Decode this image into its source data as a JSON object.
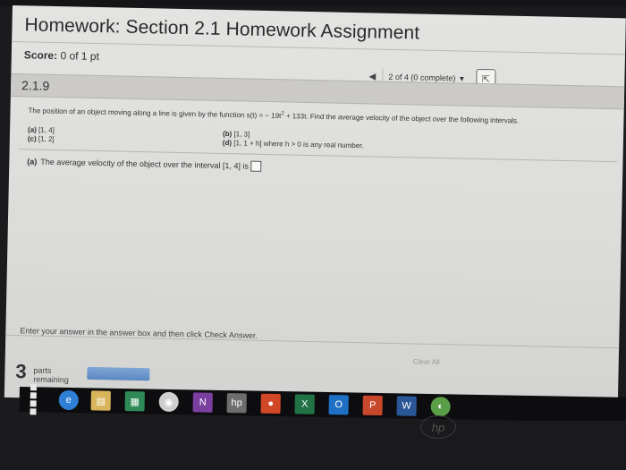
{
  "header": {
    "title": "Homework: Section 2.1 Homework Assignment",
    "score_label": "Score:",
    "score_value": "0 of 1 pt"
  },
  "navigation": {
    "position": "2 of 4 (0 complete)",
    "caret": "▼",
    "prev": "◀",
    "next": "⇱"
  },
  "question": {
    "number": "2.1.9",
    "text_before": "The position of an object moving along a line is given by the function s(t) = − 19t",
    "text_sup": "2",
    "text_after": " + 133t. Find the average velocity of the object over the following intervals.",
    "intervals": [
      {
        "label": "(a)",
        "value": "[1, 4]"
      },
      {
        "label": "(b)",
        "value": "[1, 3]"
      },
      {
        "label": "(c)",
        "value": "[1, 2]"
      },
      {
        "label": "(d)",
        "value": "[1, 1 + h] where h > 0 is any real number."
      }
    ],
    "part_a_label": "(a)",
    "part_a_text": "The average velocity of the object over the interval [1, 4] is"
  },
  "footer": {
    "instructions": "Enter your answer in the answer box and then click Check Answer.",
    "clear_all": "Clear All",
    "parts_count": "3",
    "parts_label_1": "parts",
    "parts_label_2": "remaining"
  },
  "taskbar": {
    "icons": [
      {
        "name": "edge-icon",
        "glyph": "e",
        "color": "#2f7fd6"
      },
      {
        "name": "file-explorer-icon",
        "glyph": "▤",
        "color": "#d8b45a"
      },
      {
        "name": "store-icon",
        "glyph": "▦",
        "color": "#2e8b57"
      },
      {
        "name": "media-icon",
        "glyph": "◉",
        "color": "#cfcfcf"
      },
      {
        "name": "onenote-icon",
        "glyph": "N",
        "color": "#7b3fa0"
      },
      {
        "name": "hp-icon",
        "glyph": "hp",
        "color": "#6e6e6e"
      },
      {
        "name": "office-icon",
        "glyph": "●",
        "color": "#d24726"
      },
      {
        "name": "excel-icon",
        "glyph": "X",
        "color": "#217346"
      },
      {
        "name": "outlook-icon",
        "glyph": "O",
        "color": "#1f6fc5"
      },
      {
        "name": "powerpoint-icon",
        "glyph": "P",
        "color": "#c9472b"
      },
      {
        "name": "word-icon",
        "glyph": "W",
        "color": "#2b5797"
      },
      {
        "name": "chrome-icon",
        "glyph": "◐",
        "color": "#5a9e47"
      }
    ]
  },
  "colors": {
    "screen_bg": "#dcdcda",
    "question_bar": "#cbcac8",
    "check_button": "#5c87c2",
    "taskbar": "#0d0d10"
  }
}
